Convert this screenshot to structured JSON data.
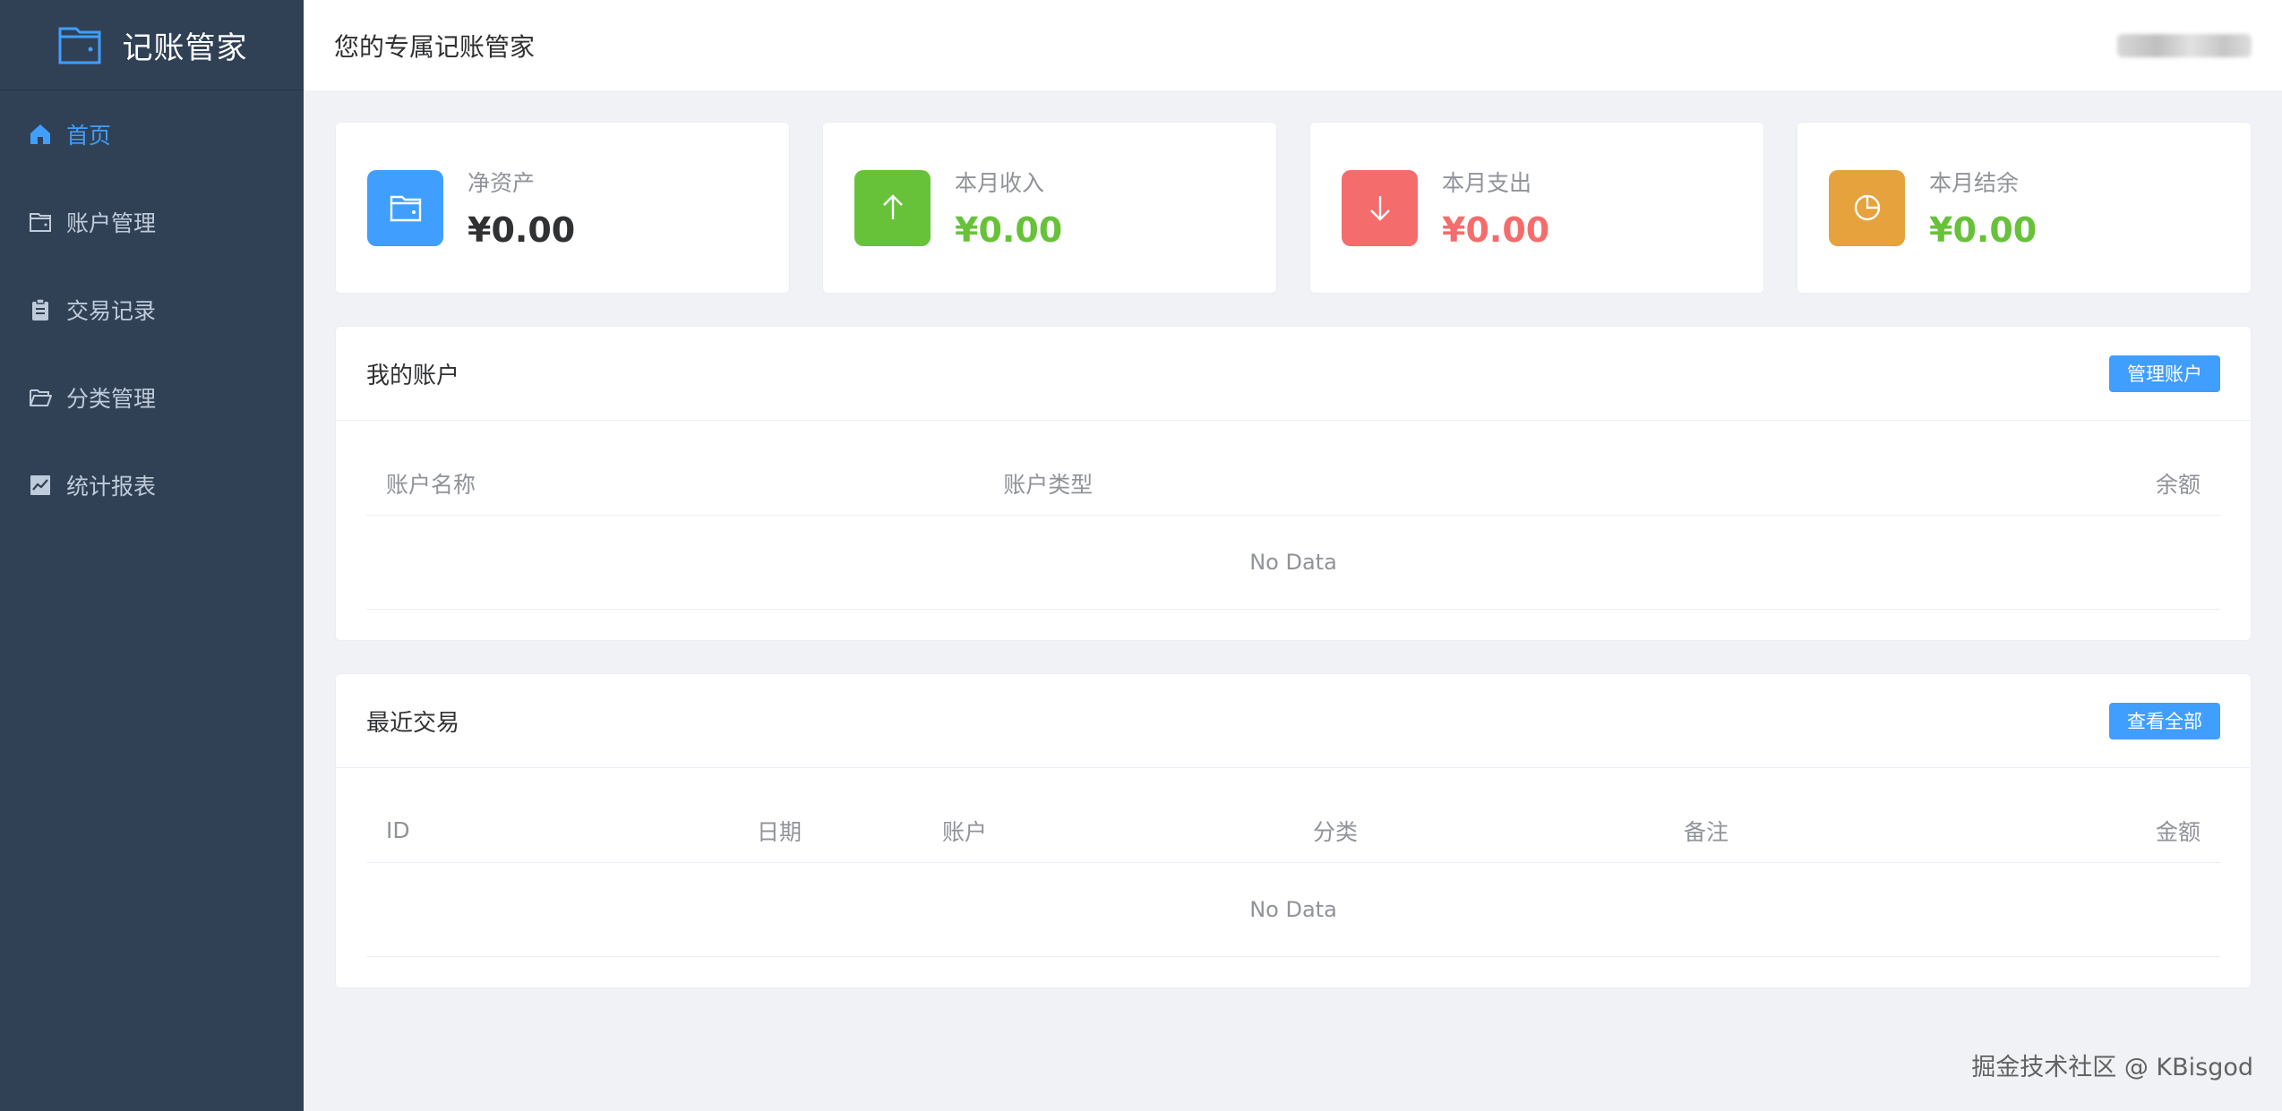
{
  "app": {
    "title": "记账管家",
    "accent": "#409eff",
    "sidebar_bg": "#304156"
  },
  "sidebar": {
    "items": [
      {
        "label": "首页",
        "icon": "home-icon",
        "active": true
      },
      {
        "label": "账户管理",
        "icon": "wallet-icon"
      },
      {
        "label": "交易记录",
        "icon": "clipboard-icon"
      },
      {
        "label": "分类管理",
        "icon": "folder-open-icon"
      },
      {
        "label": "统计报表",
        "icon": "chart-icon"
      }
    ]
  },
  "header": {
    "title": "您的专属记账管家"
  },
  "stats": [
    {
      "label": "净资产",
      "value": "¥0.00",
      "icon": "wallet-icon",
      "icon_bg": "#409eff",
      "value_color": "#303133"
    },
    {
      "label": "本月收入",
      "value": "¥0.00",
      "icon": "arrow-up-icon",
      "icon_bg": "#67c23a",
      "value_color": "#67c23a"
    },
    {
      "label": "本月支出",
      "value": "¥0.00",
      "icon": "arrow-down-icon",
      "icon_bg": "#f56c6c",
      "value_color": "#f56c6c"
    },
    {
      "label": "本月结余",
      "value": "¥0.00",
      "icon": "pie-chart-icon",
      "icon_bg": "#e6a23c",
      "value_color": "#67c23a"
    }
  ],
  "accounts": {
    "title": "我的账户",
    "button": "管理账户",
    "columns": [
      "账户名称",
      "账户类型",
      "余额"
    ],
    "empty": "No Data"
  },
  "transactions": {
    "title": "最近交易",
    "button": "查看全部",
    "columns": [
      "ID",
      "日期",
      "账户",
      "分类",
      "备注",
      "金额"
    ],
    "empty": "No Data"
  },
  "watermark": "掘金技术社区 @ KBisgod"
}
